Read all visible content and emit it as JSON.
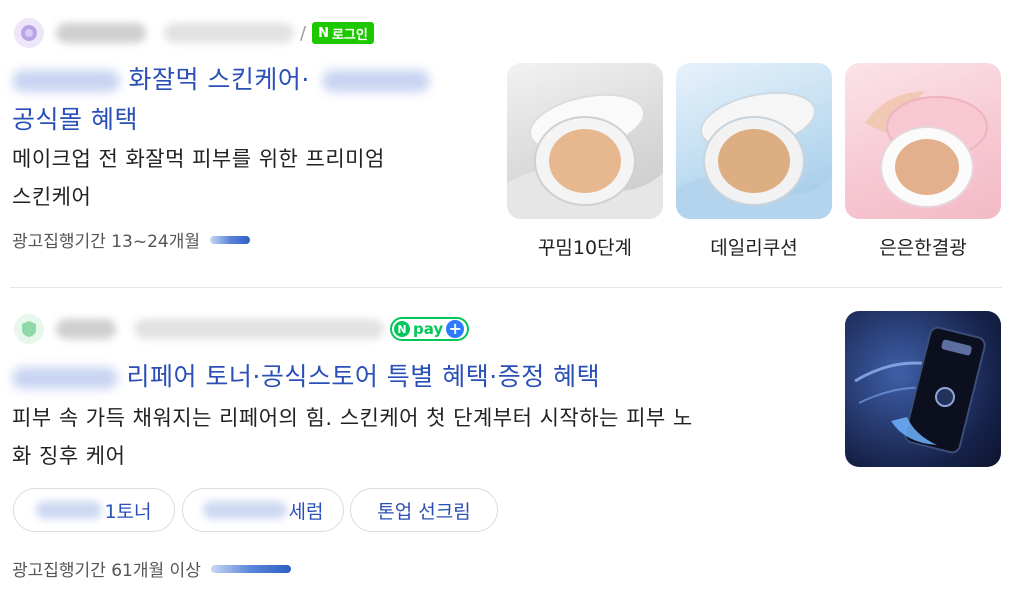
{
  "ad1": {
    "login_badge": {
      "n": "N",
      "label": "로그인"
    },
    "title_line1_suffix": "화잘먹 스킨케어·",
    "title_line2": "공식몰 혜택",
    "desc_line1": "메이크업 전 화잘먹 피부를 위한 프리미엄",
    "desc_line2": "스킨케어",
    "meta_label": "광고집행기간 13~24개월",
    "thumbnails": [
      {
        "label": "꾸밈10단계"
      },
      {
        "label": "데일리쿠션"
      },
      {
        "label": "은은한결광"
      }
    ]
  },
  "ad2": {
    "npay": {
      "n": "N",
      "label": "pay",
      "plus": "+"
    },
    "title_suffix": "리페어 토너·공식스토어 특별 혜택·증정 혜택",
    "desc_line1": "피부 속 가득 채워지는 리페어의 힘. 스킨케어 첫 단계부터 시작하는 피부 노",
    "desc_line2": "화 징후 케어",
    "chips": [
      {
        "visible_text": "1토너"
      },
      {
        "visible_text": "세럼"
      },
      {
        "visible_text": "톤업 선크림"
      }
    ],
    "meta_label": "광고집행기간 61개월 이상"
  },
  "colors": {
    "link_blue": "#2a50b8",
    "naver_green": "#1ec800",
    "npay_green": "#03c75a"
  }
}
